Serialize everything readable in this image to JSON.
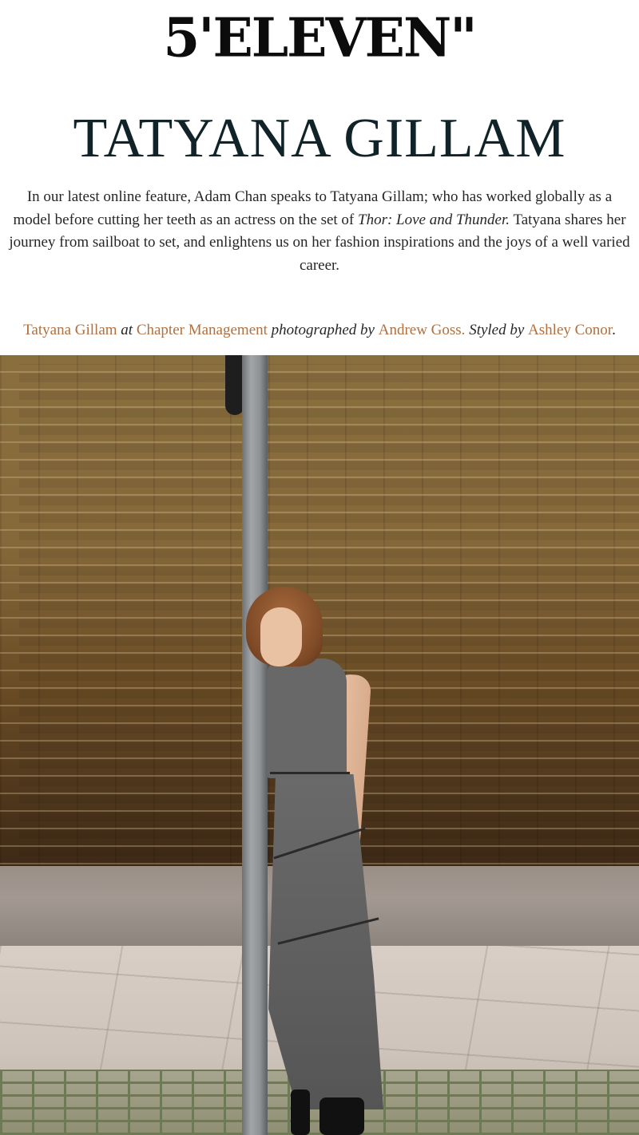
{
  "header": {
    "logo_text": "5'ELEVEN\""
  },
  "article": {
    "title": "TATYANA GILLAM",
    "intro": {
      "part1": "In our latest online feature, Adam Chan speaks to Tatyana Gillam; who has worked globally as a model before cutting her teeth as an actress on the set of ",
      "film_title": "Thor: Love and Thunder.",
      "part2": " Tatyana shares her journey from sailboat to set, and enlightens us on her fashion inspirations and the joys of a well varied career."
    },
    "credits": {
      "model_link": "Tatyana Gillam",
      "at_text": " at ",
      "agency_link": "Chapter Management",
      "photographed_by_text": " photographed by ",
      "photographer_link": "Andrew Goss.",
      "styled_by_text": " Styled by ",
      "stylist_link": "Ashley Conor",
      "end_punct": "."
    }
  },
  "colors": {
    "link": "#b07040",
    "title": "#0f2328",
    "body_text": "#262626"
  }
}
